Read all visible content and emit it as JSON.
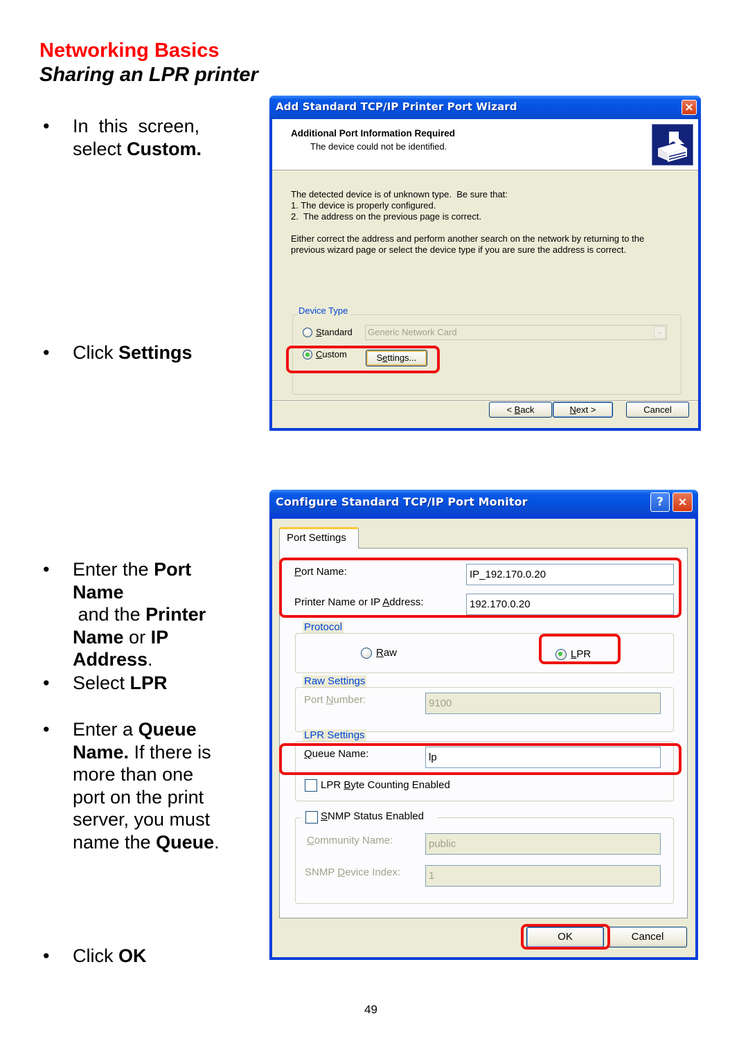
{
  "header": {
    "title": "Networking Basics",
    "subtitle": "Sharing an LPR printer"
  },
  "instructions": [
    {
      "parts": [
        {
          "text": "In  this  screen,",
          "bold": false
        },
        {
          "text": " select ",
          "bold": false
        },
        {
          "text": "Custom.",
          "bold": true
        }
      ]
    },
    {
      "parts": [
        {
          "text": "Click ",
          "bold": false
        },
        {
          "text": "Settings",
          "bold": true
        }
      ]
    },
    {
      "parts": [
        {
          "text": "Enter the ",
          "bold": false
        },
        {
          "text": "Port Name",
          "bold": true
        },
        {
          "text": " and the ",
          "bold": false
        },
        {
          "text": "Printer Name",
          "bold": true
        },
        {
          "text": " or ",
          "bold": false
        },
        {
          "text": "IP Address",
          "bold": true
        },
        {
          "text": ".",
          "bold": false
        }
      ]
    },
    {
      "parts": [
        {
          "text": "Select ",
          "bold": false
        },
        {
          "text": "LPR",
          "bold": true
        }
      ]
    },
    {
      "parts": [
        {
          "text": "Enter a ",
          "bold": false
        },
        {
          "text": "Queue Name.",
          "bold": true
        },
        {
          "text": "  If there is more than one port on the print server, you must name the ",
          "bold": false
        },
        {
          "text": "Queue",
          "bold": true
        },
        {
          "text": ".",
          "bold": false
        }
      ]
    },
    {
      "parts": [
        {
          "text": "Click ",
          "bold": false
        },
        {
          "text": "OK",
          "bold": true
        }
      ]
    }
  ],
  "bullet_glyph": "•",
  "wizard": {
    "title": "Add Standard TCP/IP Printer Port Wizard",
    "close_icon": "×",
    "header_title": "Additional Port Information Required",
    "header_subtitle": "The device could not be identified.",
    "header_icon": "printer-port-icon",
    "body_lines": [
      "The detected device is of unknown type.  Be sure that:",
      "1. The device is properly configured.",
      "2.  The address on the previous page is correct."
    ],
    "body_para": [
      "Either correct the address and perform another search on the network by returning to the",
      "previous wizard page or select the device type if you are sure the address is correct."
    ],
    "device_type_label": "Device Type",
    "standard_label_u": "S",
    "standard_label_rest": "tandard",
    "standard_selected": false,
    "standard_dropdown_value": "Generic Network Card",
    "custom_label_u": "C",
    "custom_label_rest": "ustom",
    "custom_selected": true,
    "settings_button_pre": "S",
    "settings_button_u": "e",
    "settings_button_rest": "ttings...",
    "back_button_pre": "< ",
    "back_button_u": "B",
    "back_button_rest": "ack",
    "next_button_u": "N",
    "next_button_rest": "ext >",
    "cancel_button": "Cancel"
  },
  "monitor": {
    "title": "Configure Standard TCP/IP Port Monitor",
    "help_icon": "?",
    "close_icon": "×",
    "tab_label": "Port Settings",
    "port_name_label_u": "P",
    "port_name_label_rest": "ort Name:",
    "port_name_value": "IP_192.170.0.20",
    "printer_name_label_pre": "Printer Name or IP ",
    "printer_name_label_u": "A",
    "printer_name_label_rest": "ddress:",
    "printer_name_value": "192.170.0.20",
    "protocol_label": "Protocol",
    "raw_label_u": "R",
    "raw_label_rest": "aw",
    "raw_selected": false,
    "lpr_label_u": "L",
    "lpr_label_rest": "PR",
    "lpr_selected": true,
    "raw_settings_label": "Raw Settings",
    "port_number_label_pre": "Port ",
    "port_number_label_u": "N",
    "port_number_label_rest": "umber:",
    "port_number_value": "9100",
    "lpr_settings_label": "LPR Settings",
    "queue_name_label_u": "Q",
    "queue_name_label_rest": "ueue Name:",
    "queue_name_value": "lp",
    "byte_counting_label_pre": "LPR ",
    "byte_counting_label_u": "B",
    "byte_counting_label_rest": "yte Counting Enabled",
    "byte_counting_checked": false,
    "snmp_label_u": "S",
    "snmp_label_rest": "NMP Status Enabled",
    "snmp_checked": false,
    "community_label_u": "C",
    "community_label_rest": "ommunity Name:",
    "community_value": "public",
    "device_index_label_pre": "SNMP ",
    "device_index_label_u": "D",
    "device_index_label_rest": "evice Index:",
    "device_index_value": "1",
    "ok_button": "OK",
    "cancel_button": "Cancel"
  },
  "colors": {
    "header_red": "#ff0000",
    "highlight_red": "#ee1111",
    "xp_blue": "#0a3fd8",
    "group_label_blue": "#0046d5",
    "dialog_bg": "#ecebd6"
  },
  "page_number": "49"
}
